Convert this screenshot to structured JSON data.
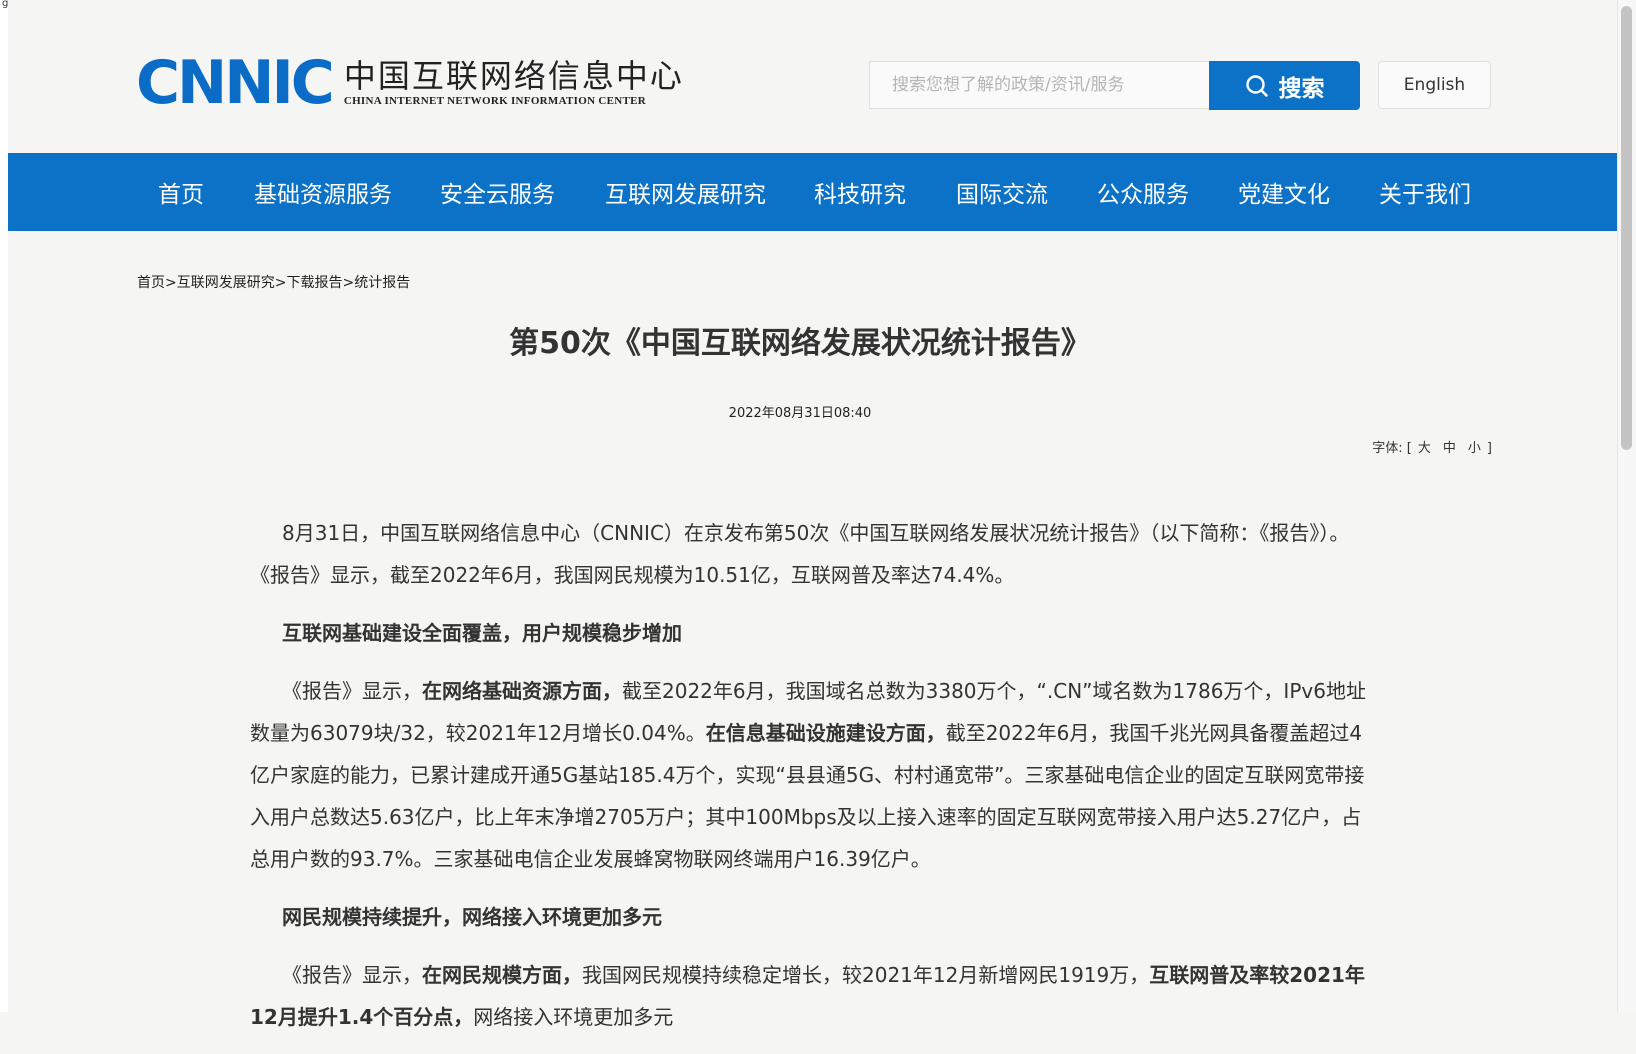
{
  "page_marker": "g",
  "header": {
    "logo_mark": "CNNIC",
    "logo_cn": "中国互联网络信息中心",
    "logo_en": "CHINA INTERNET NETWORK INFORMATION CENTER",
    "search_placeholder": "搜索您想了解的政策/资讯/服务",
    "search_button": "搜索",
    "english_link": "English"
  },
  "nav": {
    "items": [
      {
        "label": "首页"
      },
      {
        "label": "基础资源服务"
      },
      {
        "label": "安全云服务"
      },
      {
        "label": "互联网发展研究"
      },
      {
        "label": "科技研究"
      },
      {
        "label": "国际交流"
      },
      {
        "label": "公众服务"
      },
      {
        "label": "党建文化"
      },
      {
        "label": "关于我们"
      }
    ]
  },
  "breadcrumb": {
    "items": [
      "首页",
      "互联网发展研究",
      "下载报告",
      "统计报告"
    ],
    "separator": ">"
  },
  "article": {
    "title": "第50次《中国互联网络发展状况统计报告》",
    "date": "2022年08月31日08:40",
    "font_size": {
      "label": "字体:",
      "open": "[",
      "options": [
        "大",
        "中",
        "小"
      ],
      "close": "]"
    },
    "p1": "8月31日，中国互联网络信息中心（CNNIC）在京发布第50次《中国互联网络发展状况统计报告》（以下简称：《报告》）。《报告》显示，截至2022年6月，我国网民规模为10.51亿，互联网普及率达74.4%。",
    "h1": "互联网基础建设全面覆盖，用户规模稳步增加",
    "p2": {
      "a": "《报告》显示，",
      "b": "在网络基础资源方面，",
      "c": "截至2022年6月，我国域名总数为3380万个，“.CN”域名数为1786万个，IPv6地址数量为63079块/32，较2021年12月增长0.04%。",
      "d": "在信息基础设施建设方面，",
      "e": "截至2022年6月，我国千兆光网具备覆盖超过4亿户家庭的能力，已累计建成开通5G基站185.4万个，实现“县县通5G、村村通宽带”。三家基础电信企业的固定互联网宽带接入用户总数达5.63亿户，比上年末净增2705万户；其中100Mbps及以上接入速率的固定互联网宽带接入用户达5.27亿户，占总用户数的93.7%。三家基础电信企业发展蜂窝物联网终端用户16.39亿户。"
    },
    "h2": "网民规模持续提升，网络接入环境更加多元",
    "p3": {
      "a": "《报告》显示，",
      "b": "在网民规模方面，",
      "c": "我国网民规模持续稳定增长，较2021年12月新增网民1919万，",
      "d": "互联网普及率较2021年12月提升1.4个百分点，",
      "e": "网络接入环境更加多元"
    }
  }
}
